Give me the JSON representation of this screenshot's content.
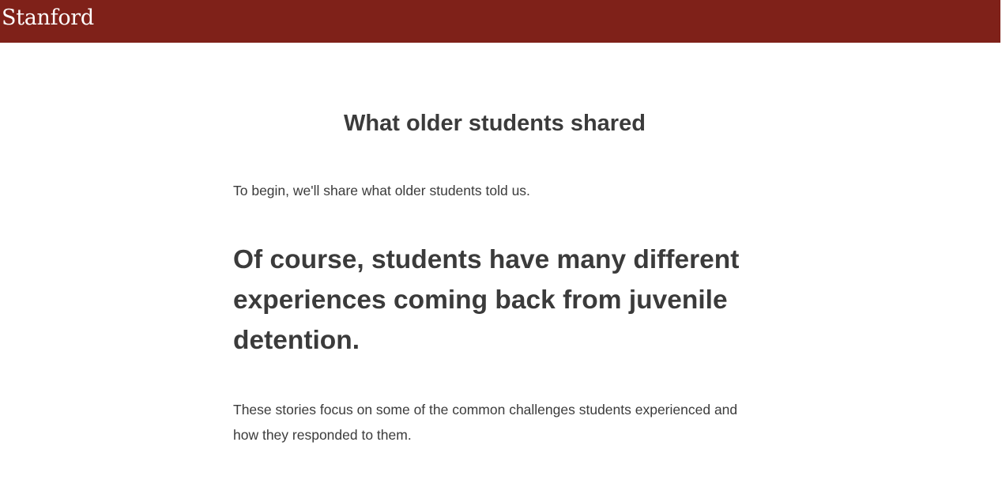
{
  "header": {
    "brand": "Stanford",
    "background_color": "#7f2119"
  },
  "main": {
    "title": "What older students shared",
    "intro": "To begin, we'll share what older students told us.",
    "headline": "Of course, students have many different experiences coming back from juvenile detention.",
    "body": "These stories focus on some of the common challenges students experienced and how they responded to them."
  },
  "colors": {
    "text": "#3b3b3b",
    "background": "#ffffff"
  }
}
